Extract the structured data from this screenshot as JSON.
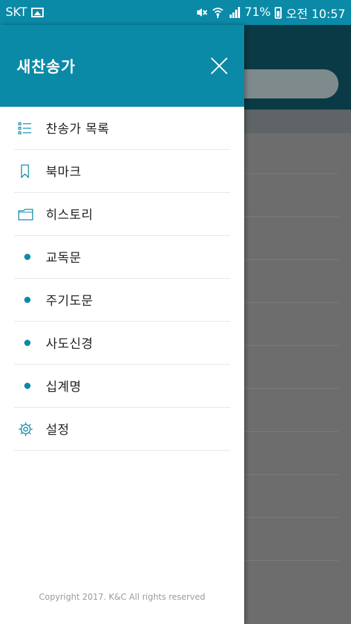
{
  "statusbar": {
    "carrier": "SKT",
    "battery": "71%",
    "time": "오전 10:57"
  },
  "drawer": {
    "title": "새찬송가",
    "items": [
      {
        "label": "찬송가 목록",
        "icon": "list-icon"
      },
      {
        "label": "북마크",
        "icon": "bookmark-icon"
      },
      {
        "label": "히스토리",
        "icon": "folder-icon"
      },
      {
        "label": "교독문",
        "icon": "dot-icon"
      },
      {
        "label": "주기도문",
        "icon": "dot-icon"
      },
      {
        "label": "사도신경",
        "icon": "dot-icon"
      },
      {
        "label": "십계명",
        "icon": "dot-icon"
      },
      {
        "label": "설정",
        "icon": "gear-icon"
      }
    ],
    "footer": "Copyright 2017. K&C All rights reserved"
  },
  "colors": {
    "accent": "#0b8aa8",
    "overlay": "#6f6f6f",
    "dark_header": "#0a3a46"
  }
}
